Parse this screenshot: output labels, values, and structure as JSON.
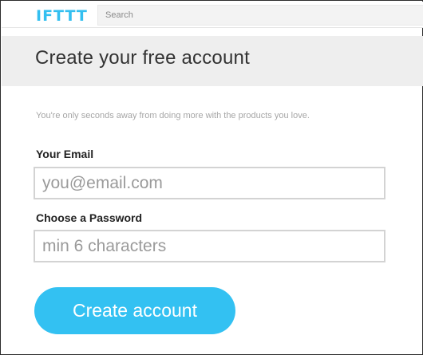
{
  "header": {
    "logo_text": "IFTTT",
    "search_placeholder": "Search"
  },
  "page": {
    "title": "Create your free account",
    "tagline": "You're only seconds away from doing more with the products you love."
  },
  "form": {
    "email_label": "Your Email",
    "email_placeholder": "you@email.com",
    "password_label": "Choose a Password",
    "password_placeholder": "min 6 characters",
    "submit_label": "Create account"
  },
  "colors": {
    "brand": "#33c1f2",
    "title_band": "#eeeeee",
    "field_border": "#d3d3d3"
  }
}
